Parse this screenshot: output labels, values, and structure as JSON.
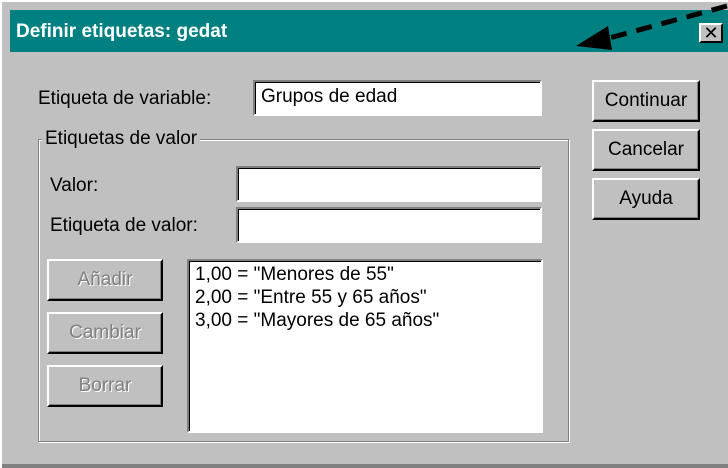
{
  "window": {
    "title": "Definir etiquetas: gedat",
    "close_label": "✕"
  },
  "form": {
    "variable_label": "Etiqueta de variable:",
    "variable_value": "Grupos de edad",
    "group_title": "Etiquetas de valor",
    "value_label": "Valor:",
    "value_value": "",
    "value_label_label": "Etiqueta de valor:",
    "value_label_value": ""
  },
  "actions": {
    "add": "Añadir",
    "change": "Cambiar",
    "remove": "Borrar"
  },
  "value_list": [
    "1,00 = \"Menores de 55\"",
    "2,00 = \"Entre 55 y 65 años\"",
    "3,00 = \"Mayores de 65 años\""
  ],
  "buttons": {
    "continue": "Continuar",
    "cancel": "Cancelar",
    "help": "Ayuda"
  },
  "colors": {
    "titlebar": "#008080",
    "face": "#c0c0c0"
  }
}
